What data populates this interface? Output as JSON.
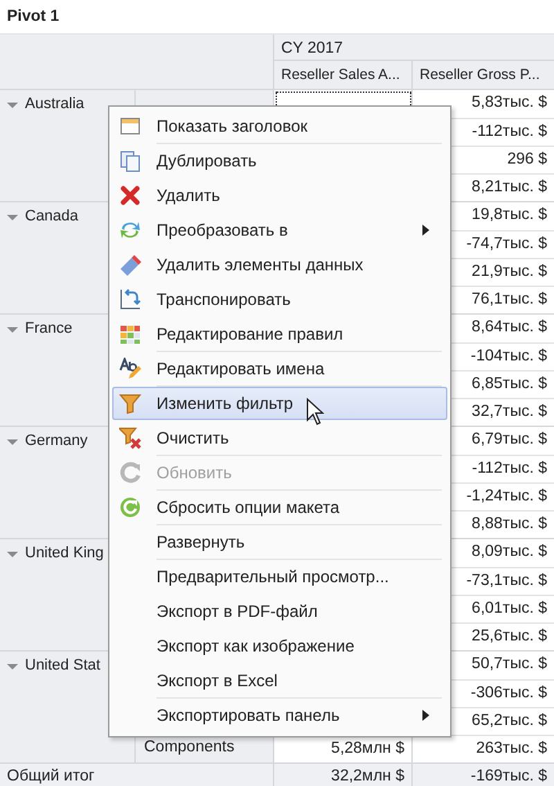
{
  "title": "Pivot 1",
  "column_header": "CY 2017",
  "columns": [
    "Reseller Sales A...",
    "Reseller Gross P..."
  ],
  "groups": [
    {
      "country": "Australia",
      "expanded": true,
      "rows": [
        {
          "value_2": "5,83тыс. $",
          "focused": true
        },
        {
          "value_2": "-112тыс. $"
        },
        {
          "value_2": "296 $"
        },
        {
          "value_2": "8,21тыс. $"
        }
      ]
    },
    {
      "country": "Canada",
      "expanded": true,
      "rows": [
        {
          "value_2": "19,8тыс. $"
        },
        {
          "value_2": "-74,7тыс. $"
        },
        {
          "value_2": "21,9тыс. $"
        },
        {
          "value_2": "76,1тыс. $"
        }
      ]
    },
    {
      "country": "France",
      "expanded": true,
      "rows": [
        {
          "value_2": "8,64тыс. $"
        },
        {
          "value_2": "-104тыс. $"
        },
        {
          "value_2": "6,85тыс. $"
        },
        {
          "value_2": "32,7тыс. $"
        }
      ]
    },
    {
      "country": "Germany",
      "expanded": true,
      "rows": [
        {
          "value_2": "6,79тыс. $"
        },
        {
          "value_2": "-112тыс. $"
        },
        {
          "value_2": "-1,24тыс. $"
        },
        {
          "value_2": "8,88тыс. $"
        }
      ]
    },
    {
      "country": "United King",
      "expanded": true,
      "rows": [
        {
          "value_2": "8,09тыс. $"
        },
        {
          "value_2": "-73,1тыс. $"
        },
        {
          "value_2": "6,01тыс. $"
        },
        {
          "value_2": "25,6тыс. $"
        }
      ]
    },
    {
      "country": "United Stat",
      "expanded": true,
      "rows": [
        {
          "value_2": "50,7тыс. $"
        },
        {
          "value_2": "-306тыс. $"
        },
        {
          "value_2": "65,2тыс. $"
        },
        {
          "category": "Components",
          "value_1": "5,28млн $",
          "value_2": "263тыс. $"
        }
      ]
    }
  ],
  "grand_total": {
    "label": "Общий итог",
    "value_1": "32,2млн $",
    "value_2": "-169тыс. $"
  },
  "context_menu": [
    {
      "label": "Показать заголовок",
      "kind": "header",
      "separator_after": true,
      "submenu": false,
      "disabled": false,
      "selected": false
    },
    {
      "label": "Дублировать",
      "kind": "duplicate",
      "separator_after": false,
      "submenu": false,
      "disabled": false,
      "selected": false
    },
    {
      "label": "Удалить",
      "kind": "delete",
      "separator_after": false,
      "submenu": false,
      "disabled": false,
      "selected": false
    },
    {
      "label": "Преобразовать в",
      "kind": "convert",
      "separator_after": false,
      "submenu": true,
      "disabled": false,
      "selected": false
    },
    {
      "label": "Удалить элементы данных",
      "kind": "eraser",
      "separator_after": false,
      "submenu": false,
      "disabled": false,
      "selected": false
    },
    {
      "label": "Транспонировать",
      "kind": "transpose",
      "separator_after": false,
      "submenu": false,
      "disabled": false,
      "selected": false
    },
    {
      "label": "Редактирование правил",
      "kind": "rules",
      "separator_after": true,
      "submenu": false,
      "disabled": false,
      "selected": false
    },
    {
      "label": "Редактировать имена",
      "kind": "rename",
      "separator_after": true,
      "submenu": false,
      "disabled": false,
      "selected": false
    },
    {
      "label": "Изменить фильтр",
      "kind": "filter",
      "separator_after": false,
      "submenu": false,
      "disabled": false,
      "selected": true
    },
    {
      "label": "Очистить",
      "kind": "clear",
      "separator_after": true,
      "submenu": false,
      "disabled": false,
      "selected": false
    },
    {
      "label": "Обновить",
      "kind": "refresh",
      "separator_after": true,
      "submenu": false,
      "disabled": true,
      "selected": false
    },
    {
      "label": "Сбросить опции макета",
      "kind": "reset",
      "separator_after": true,
      "submenu": false,
      "disabled": false,
      "selected": false
    },
    {
      "label": "Развернуть",
      "separator_after": true,
      "submenu": false,
      "disabled": false,
      "selected": false
    },
    {
      "label": "Предварительный просмотр...",
      "separator_after": false,
      "submenu": false,
      "disabled": false,
      "selected": false
    },
    {
      "label": "Экспорт в PDF-файл",
      "separator_after": false,
      "submenu": false,
      "disabled": false,
      "selected": false
    },
    {
      "label": "Экспорт как изображение",
      "separator_after": false,
      "submenu": false,
      "disabled": false,
      "selected": false
    },
    {
      "label": "Экспорт в Excel",
      "separator_after": true,
      "submenu": false,
      "disabled": false,
      "selected": false
    },
    {
      "label": "Экспортировать панель",
      "separator_after": false,
      "submenu": true,
      "disabled": false,
      "selected": false
    }
  ]
}
